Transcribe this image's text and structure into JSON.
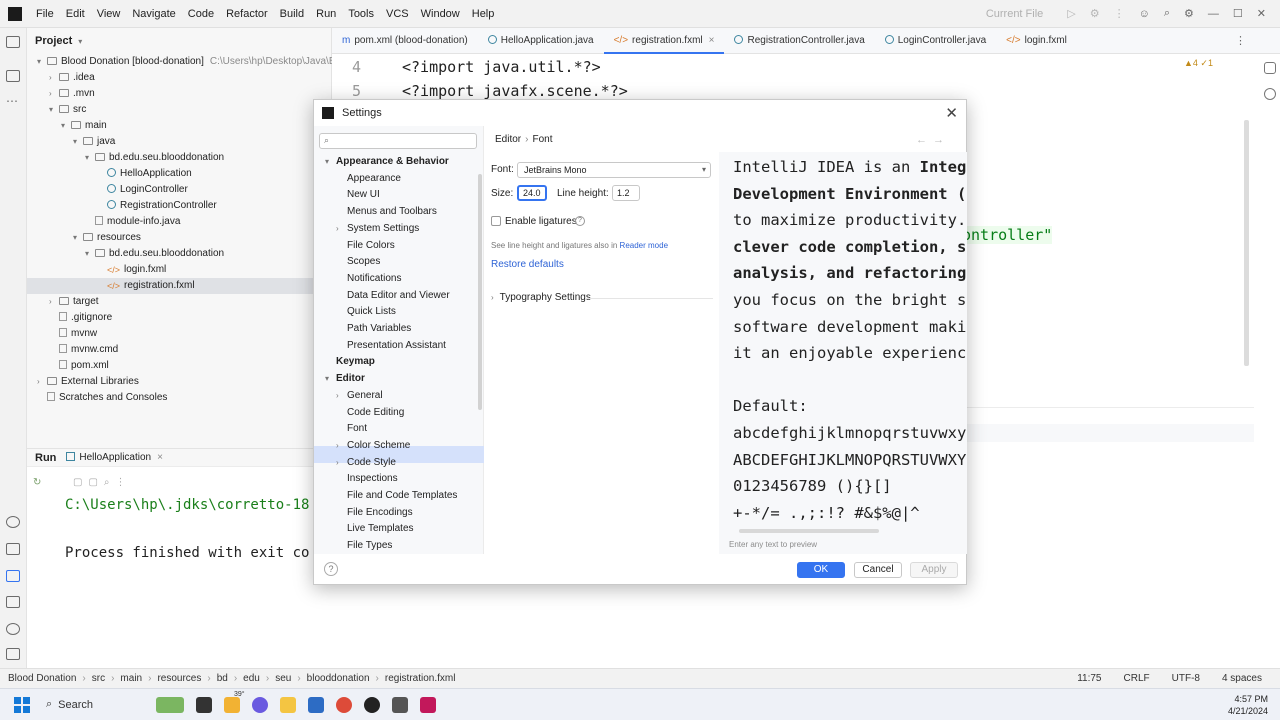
{
  "menubar": {
    "items": [
      "File",
      "Edit",
      "View",
      "Navigate",
      "Code",
      "Refactor",
      "Build",
      "Run",
      "Tools",
      "VCS",
      "Window",
      "Help"
    ],
    "run_config": "Current File"
  },
  "project": {
    "title": "Project",
    "tree": [
      {
        "label": "Blood Donation [blood-donation]",
        "extra": "C:\\Users\\hp\\Desktop\\Java\\Blo",
        "type": "folder",
        "indent": 0,
        "arrow": "v"
      },
      {
        "label": ".idea",
        "type": "folder",
        "indent": 1,
        "arrow": ">"
      },
      {
        "label": ".mvn",
        "type": "folder",
        "indent": 1,
        "arrow": ">"
      },
      {
        "label": "src",
        "type": "folder",
        "indent": 1,
        "arrow": "v"
      },
      {
        "label": "main",
        "type": "folder",
        "indent": 2,
        "arrow": "v"
      },
      {
        "label": "java",
        "type": "folder",
        "indent": 3,
        "arrow": "v"
      },
      {
        "label": "bd.edu.seu.blooddonation",
        "type": "folder",
        "indent": 4,
        "arrow": "v"
      },
      {
        "label": "HelloApplication",
        "type": "class",
        "indent": 5,
        "arrow": ""
      },
      {
        "label": "LoginController",
        "type": "class",
        "indent": 5,
        "arrow": ""
      },
      {
        "label": "RegistrationController",
        "type": "class",
        "indent": 5,
        "arrow": ""
      },
      {
        "label": "module-info.java",
        "type": "file",
        "indent": 4,
        "arrow": ""
      },
      {
        "label": "resources",
        "type": "folder",
        "indent": 3,
        "arrow": "v"
      },
      {
        "label": "bd.edu.seu.blooddonation",
        "type": "folder",
        "indent": 4,
        "arrow": "v"
      },
      {
        "label": "login.fxml",
        "type": "fxml",
        "indent": 5,
        "arrow": ""
      },
      {
        "label": "registration.fxml",
        "type": "fxml",
        "indent": 5,
        "arrow": "",
        "selected": true
      },
      {
        "label": "target",
        "type": "folder",
        "indent": 1,
        "arrow": ">"
      },
      {
        "label": ".gitignore",
        "type": "file",
        "indent": 1,
        "arrow": ""
      },
      {
        "label": "mvnw",
        "type": "file",
        "indent": 1,
        "arrow": ""
      },
      {
        "label": "mvnw.cmd",
        "type": "file",
        "indent": 1,
        "arrow": ""
      },
      {
        "label": "pom.xml",
        "type": "file",
        "indent": 1,
        "arrow": ""
      },
      {
        "label": "External Libraries",
        "type": "folder",
        "indent": 0,
        "arrow": ">"
      },
      {
        "label": "Scratches and Consoles",
        "type": "file",
        "indent": 0,
        "arrow": ""
      }
    ]
  },
  "tabs": [
    {
      "label": "pom.xml (blood-donation)",
      "kind": "m"
    },
    {
      "label": "HelloApplication.java",
      "kind": "c"
    },
    {
      "label": "registration.fxml",
      "kind": "x",
      "active": true
    },
    {
      "label": "RegistrationController.java",
      "kind": "c"
    },
    {
      "label": "LoginController.java",
      "kind": "c"
    },
    {
      "label": "login.fxml",
      "kind": "x"
    }
  ],
  "editor": {
    "lines": [
      {
        "num": "4",
        "text": "<?import java.util.*?>"
      },
      {
        "num": "5",
        "text": "<?import javafx.scene.*?>"
      }
    ],
    "fragment": "ontroller\"",
    "warnings": "▲4 ✓1"
  },
  "run": {
    "title": "Run",
    "config": "HelloApplication",
    "console": [
      "C:\\Users\\hp\\.jdks\\corretto-18",
      "Process finished with exit co"
    ]
  },
  "statusbar": {
    "breadcrumb": [
      "Blood Donation",
      "src",
      "main",
      "resources",
      "bd",
      "edu",
      "seu",
      "blooddonation",
      "registration.fxml"
    ],
    "position": "11:75",
    "line_sep": "CRLF",
    "encoding": "UTF-8",
    "indent": "4 spaces"
  },
  "taskbar": {
    "search": "Search",
    "badge": "39°",
    "time": "4:57 PM",
    "date": "4/21/2024"
  },
  "dialog": {
    "title": "Settings",
    "search_placeholder": "",
    "breadcrumb": [
      "Editor",
      "Font"
    ],
    "tree": [
      {
        "label": "Appearance & Behavior",
        "bold": true,
        "indent": 0,
        "arrow": "v"
      },
      {
        "label": "Appearance",
        "indent": 1
      },
      {
        "label": "New UI",
        "indent": 1
      },
      {
        "label": "Menus and Toolbars",
        "indent": 1
      },
      {
        "label": "System Settings",
        "indent": 1,
        "arrow": ">"
      },
      {
        "label": "File Colors",
        "indent": 1,
        "mark": true
      },
      {
        "label": "Scopes",
        "indent": 1,
        "mark": true
      },
      {
        "label": "Notifications",
        "indent": 1
      },
      {
        "label": "Data Editor and Viewer",
        "indent": 1
      },
      {
        "label": "Quick Lists",
        "indent": 1
      },
      {
        "label": "Path Variables",
        "indent": 1
      },
      {
        "label": "Presentation Assistant",
        "indent": 1
      },
      {
        "label": "Keymap",
        "bold": true,
        "indent": 0
      },
      {
        "label": "Editor",
        "bold": true,
        "indent": 0,
        "arrow": "v"
      },
      {
        "label": "General",
        "indent": 1,
        "arrow": ">"
      },
      {
        "label": "Code Editing",
        "indent": 1
      },
      {
        "label": "Font",
        "indent": 1,
        "selected": true
      },
      {
        "label": "Color Scheme",
        "indent": 1,
        "arrow": ">"
      },
      {
        "label": "Code Style",
        "indent": 1,
        "arrow": ">"
      },
      {
        "label": "Inspections",
        "indent": 1,
        "mark": true
      },
      {
        "label": "File and Code Templates",
        "indent": 1
      },
      {
        "label": "File Encodings",
        "indent": 1,
        "mark": true
      },
      {
        "label": "Live Templates",
        "indent": 1
      },
      {
        "label": "File Types",
        "indent": 1
      }
    ],
    "font": {
      "font_label": "Font:",
      "font_value": "JetBrains Mono",
      "size_label": "Size:",
      "size_value": "24.0",
      "line_height_label": "Line height:",
      "line_height_value": "1.2",
      "ligatures_label": "Enable ligatures",
      "ligatures_checked": false,
      "note": "See line height and ligatures also in",
      "note_link": "Reader mode",
      "restore": "Restore defaults",
      "typography": "Typography Settings"
    },
    "preview": {
      "lines": [
        {
          "text": "IntelliJ IDEA is an Integ",
          "bold_from": 20
        },
        {
          "text": "Development Environment (",
          "bold": true
        },
        {
          "text": "to maximize productivity."
        },
        {
          "text": "clever code completion, s",
          "bold": true
        },
        {
          "text": "analysis, and refactorings",
          "bold": true
        },
        {
          "text": "you focus on the bright si"
        },
        {
          "text": "software development makir"
        },
        {
          "text": "it an enjoyable experience"
        },
        {
          "text": ""
        },
        {
          "text": "Default:"
        },
        {
          "text": "abcdefghijklmnopqrstuvwxyz"
        },
        {
          "text": "ABCDEFGHIJKLMNOPQRSTUVWXYZ"
        },
        {
          "text": " 0123456789 (){}[]"
        },
        {
          "text": " +-*/= .,;:!? #&$%@|^"
        }
      ],
      "hint": "Enter any text to preview"
    },
    "buttons": {
      "ok": "OK",
      "cancel": "Cancel",
      "apply": "Apply"
    }
  }
}
